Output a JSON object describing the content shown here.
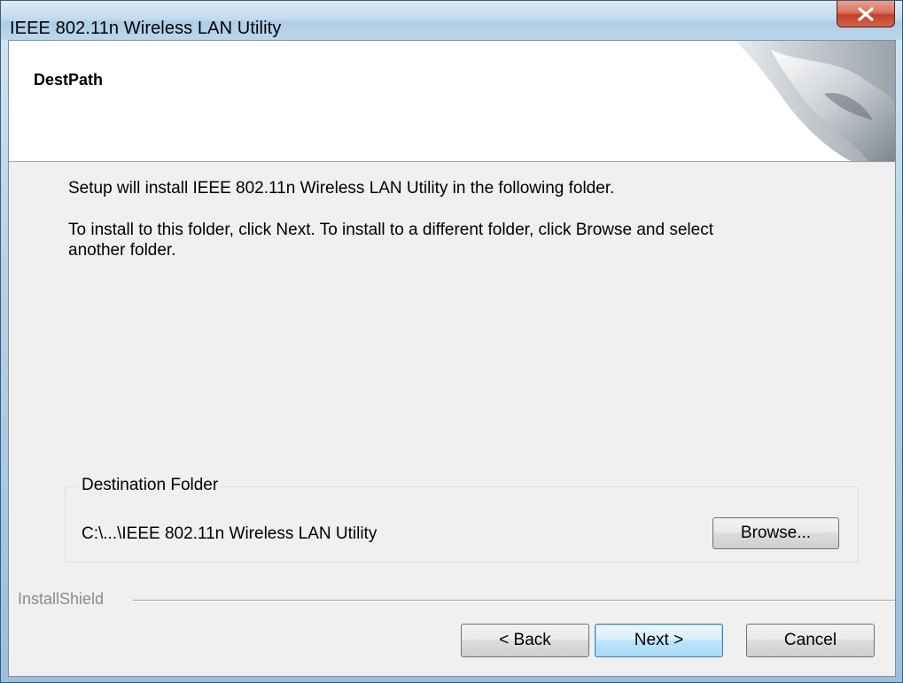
{
  "window": {
    "title": "IEEE 802.11n Wireless LAN Utility"
  },
  "header": {
    "title": "DestPath"
  },
  "content": {
    "line1": "Setup will install IEEE 802.11n Wireless LAN Utility in the following folder.",
    "line2a": "To install to this folder, click Next. To install to a different folder, click Browse and select",
    "line2b": "another folder."
  },
  "destination": {
    "group_label": "Destination Folder",
    "path": "C:\\...\\IEEE 802.11n Wireless LAN Utility",
    "browse_label": "Browse..."
  },
  "footer": {
    "brand": "InstallShield",
    "back_label": "< Back",
    "next_label": "Next >",
    "cancel_label": "Cancel"
  },
  "icons": {
    "close": "close-icon"
  }
}
